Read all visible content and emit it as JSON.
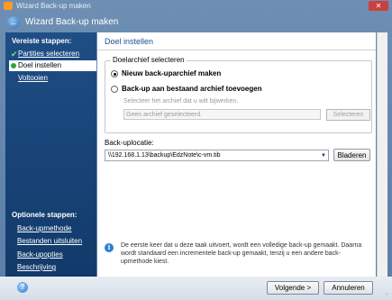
{
  "window": {
    "title": "Wizard Back-up maken",
    "close_label": "✕"
  },
  "header": {
    "title": "Wizard Back-up maken"
  },
  "sidebar": {
    "required_title": "Vereiste stappen:",
    "steps": [
      {
        "label": "Partities selecteren",
        "state": "done"
      },
      {
        "label": "Doel instellen",
        "state": "current"
      },
      {
        "label": "Voltooien",
        "state": "todo"
      }
    ],
    "optional_title": "Optionele stappen:",
    "optional": [
      {
        "label": "Back-upmethode"
      },
      {
        "label": "Bestanden uitsluiten"
      },
      {
        "label": "Back-upopties"
      },
      {
        "label": "Beschrijving"
      }
    ]
  },
  "main": {
    "heading": "Doel instellen",
    "archive_group": {
      "legend": "Doelarchief selecteren",
      "option_new": "Nieuw back-uparchief maken",
      "option_existing": "Back-up aan bestaand archief toevoegen",
      "help": "Selecteer het archief dat u wilt bijwerken.",
      "field_value": "Geen archief geselecteerd.",
      "browse_disabled": "Selecteren",
      "selected": "new"
    },
    "location_label": "Back-uplocatie:",
    "location_value": "\\\\192.168.1.13\\backup\\EdzNote\\c-vm.tib",
    "browse": "Bladeren",
    "info": "De eerste keer dat u deze taak uitvoert, wordt een volledige back-up gemaakt. Daarna wordt standaard een incrementele back-up gemaakt, tenzij u een andere back-upmethode kiest."
  },
  "footer": {
    "next": "Volgende >",
    "cancel": "Annuleren"
  },
  "colors": {
    "accent": "#1b4f8f",
    "sidebar": "#1e4e85",
    "chrome": "#6e8fb3"
  }
}
